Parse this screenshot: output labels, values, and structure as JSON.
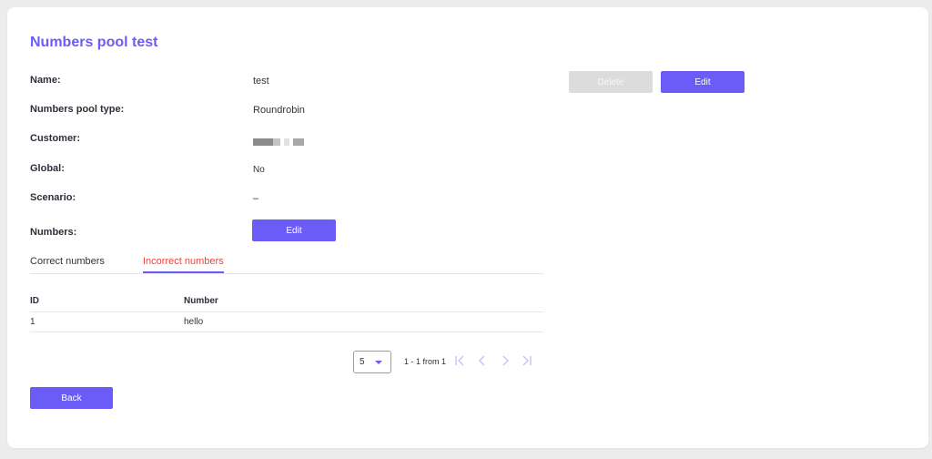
{
  "page": {
    "title": "Numbers pool test"
  },
  "fields": {
    "name": {
      "label": "Name:",
      "value": "test"
    },
    "pool_type": {
      "label": "Numbers pool type:",
      "value": "Roundrobin"
    },
    "customer": {
      "label": "Customer:"
    },
    "global": {
      "label": "Global:",
      "value": "No"
    },
    "scenario": {
      "label": "Scenario:",
      "value": "–"
    },
    "numbers": {
      "label": "Numbers:",
      "edit_label": "Edit"
    }
  },
  "actions": {
    "delete_label": "Delete",
    "edit_label": "Edit",
    "back_label": "Back"
  },
  "tabs": [
    {
      "label": "Correct numbers",
      "active": false
    },
    {
      "label": "Incorrect numbers",
      "active": true
    }
  ],
  "table": {
    "headers": [
      "ID",
      "Number"
    ],
    "rows": [
      {
        "id": "1",
        "number": "hello"
      }
    ]
  },
  "pagination": {
    "page_size": "5",
    "info": "1 - 1 from 1"
  },
  "colors": {
    "accent": "#6c5cf7",
    "active_tab": "#f2443c",
    "disabled": "#dcdcdc"
  }
}
